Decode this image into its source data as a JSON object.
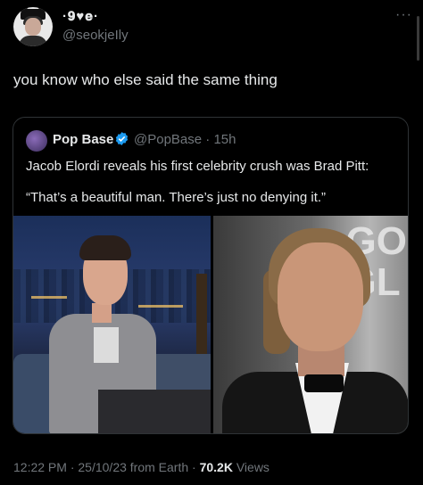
{
  "author": {
    "display_name": "·𝟗♥𝐞·",
    "handle": "@seokjeIly"
  },
  "more_label": "···",
  "tweet": {
    "text": "you know who else said the same thing"
  },
  "quoted": {
    "name": "Pop Base",
    "handle": "@PopBase",
    "separator": "·",
    "time": "15h",
    "line1": "Jacob Elordi reveals his first celebrity crush was Brad Pitt:",
    "line2": "“That’s a beautiful man. There’s just no denying it.”",
    "photo_right_text": "GO\nGL"
  },
  "footer": {
    "time": "12:22 PM",
    "date": "25/10/23",
    "source": "from Earth",
    "views_count": "70.2K",
    "views_label": "Views"
  },
  "colors": {
    "background": "#000000",
    "text_primary": "#e7e9ea",
    "text_secondary": "#71767b",
    "verified": "#1d9bf0"
  }
}
